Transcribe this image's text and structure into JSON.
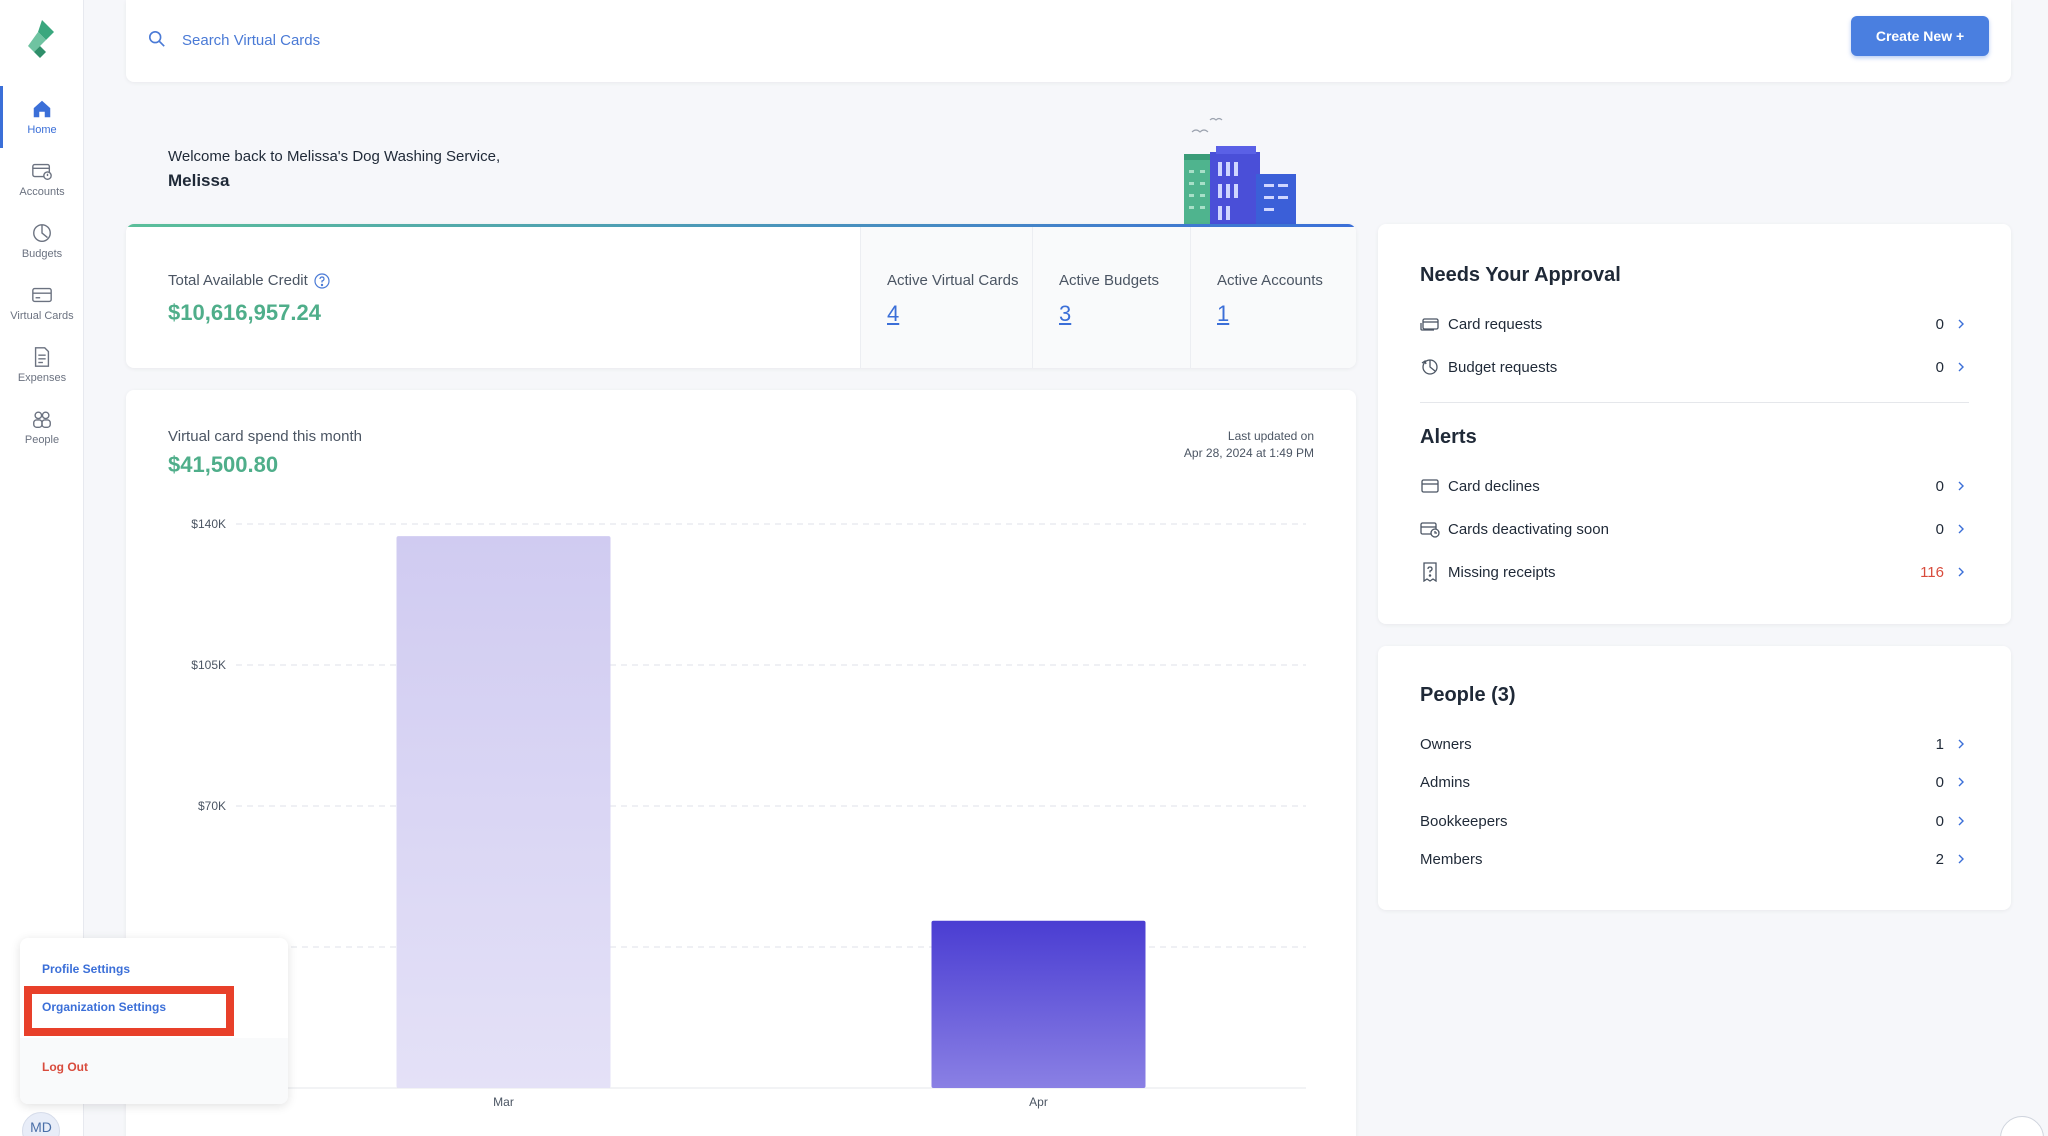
{
  "sidebar": {
    "items": [
      {
        "label": "Home",
        "icon": "home-icon",
        "active": true
      },
      {
        "label": "Accounts",
        "icon": "accounts-icon"
      },
      {
        "label": "Budgets",
        "icon": "budgets-icon"
      },
      {
        "label": "Virtual Cards",
        "icon": "virtual-cards-icon"
      },
      {
        "label": "Expenses",
        "icon": "expenses-icon"
      },
      {
        "label": "People",
        "icon": "people-icon"
      }
    ]
  },
  "search": {
    "placeholder": "Search Virtual Cards"
  },
  "header": {
    "create_label": "Create New +"
  },
  "welcome": {
    "line": "Welcome back to Melissa's Dog Washing Service,",
    "name": "Melissa"
  },
  "summary": {
    "credit_label": "Total Available Credit",
    "credit_value": "$10,616,957.24",
    "stats": [
      {
        "label": "Active Virtual Cards",
        "value": "4"
      },
      {
        "label": "Active Budgets",
        "value": "3"
      },
      {
        "label": "Active Accounts",
        "value": "1"
      }
    ]
  },
  "spend": {
    "title": "Virtual card spend this month",
    "total": "$41,500.80",
    "updated_label": "Last updated on",
    "updated_date": "Apr 28, 2024 at 1:49 PM"
  },
  "chart_data": {
    "type": "bar",
    "categories": [
      "Mar",
      "Apr"
    ],
    "values": [
      137000,
      41500.8
    ],
    "ylim": [
      0,
      140000
    ],
    "yticks": [
      {
        "value": 140000,
        "label": "$140K"
      },
      {
        "value": 105000,
        "label": "$105K"
      },
      {
        "value": 70000,
        "label": "$70K"
      },
      {
        "value": 35000,
        "label": ""
      }
    ],
    "colors": [
      "#d4d0f2",
      "#4a3fd4"
    ],
    "grid": true,
    "title": "",
    "xlabel": "",
    "ylabel": ""
  },
  "approval": {
    "title": "Needs Your Approval",
    "items": [
      {
        "label": "Card requests",
        "count": "0",
        "icon": "card-request-icon"
      },
      {
        "label": "Budget requests",
        "count": "0",
        "icon": "budget-request-icon"
      }
    ]
  },
  "alerts": {
    "title": "Alerts",
    "items": [
      {
        "label": "Card declines",
        "count": "0",
        "icon": "card-decline-icon"
      },
      {
        "label": "Cards deactivating soon",
        "count": "0",
        "icon": "card-deactivating-icon"
      },
      {
        "label": "Missing receipts",
        "count": "116",
        "icon": "missing-receipt-icon",
        "danger": true
      }
    ]
  },
  "people": {
    "title": "People (3)",
    "items": [
      {
        "label": "Owners",
        "count": "1"
      },
      {
        "label": "Admins",
        "count": "0"
      },
      {
        "label": "Bookkeepers",
        "count": "0"
      },
      {
        "label": "Members",
        "count": "2"
      }
    ]
  },
  "menu": {
    "profile": "Profile Settings",
    "organization": "Organization Settings",
    "logout": "Log Out"
  },
  "user": {
    "initials": "MD"
  },
  "colors": {
    "accent": "#3b6fd8",
    "money": "#4fae8a",
    "danger": "#d84b3c",
    "highlight": "#e8402a"
  }
}
